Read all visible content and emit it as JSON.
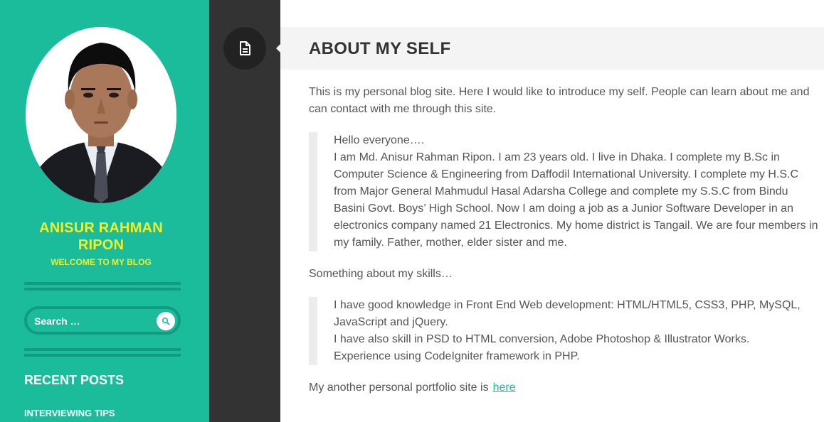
{
  "sidebar": {
    "site_title": "ANISUR RAHMAN RIPON",
    "site_description": "WELCOME TO MY BLOG",
    "search_placeholder": "Search …",
    "recent_posts_title": "RECENT POSTS",
    "recent_posts": [
      "INTERVIEWING TIPS"
    ]
  },
  "post": {
    "format_icon": "document-icon",
    "title": "ABOUT MY SELF",
    "intro": "This is my personal blog site. Here I would like to introduce my self. People can learn about me and can contact with me through this site.",
    "quote1_line1": "Hello everyone….",
    "quote1_line2": "I am Md. Anisur Rahman Ripon. I am 23 years old. I live in Dhaka. I complete my B.Sc in Computer Science  & Engineering from Daffodil International University. I complete my H.S.C from Major General Mahmudul Hasal Adarsha College and complete my S.S.C from Bindu Basini Govt. Boys’ High School. Now I am doing a job as a Junior Software Developer in an electronics company named 21 Electronics. My home district is Tangail. We are four members in my family. Father, mother, elder sister and me.",
    "skills_heading": "Something about my skills…",
    "quote2_line1": "I have good knowledge in Front End Web development: HTML/HTML5, CSS3, PHP, MySQL, JavaScript and jQuery.",
    "quote2_line2": "I have also skill in PSD to HTML conversion, Adobe Photoshop & Illustrator Works.",
    "quote2_line3": "Experience using CodeIgniter framework in PHP.",
    "portfolio_text": "My another personal portfolio site is",
    "portfolio_link": "here"
  },
  "colors": {
    "sidebar_bg": "#1abc9c",
    "sidebar_dark": "#129b80",
    "title_yellow": "#f1f12a",
    "dark_column": "#333333",
    "link": "#1abc9c"
  }
}
